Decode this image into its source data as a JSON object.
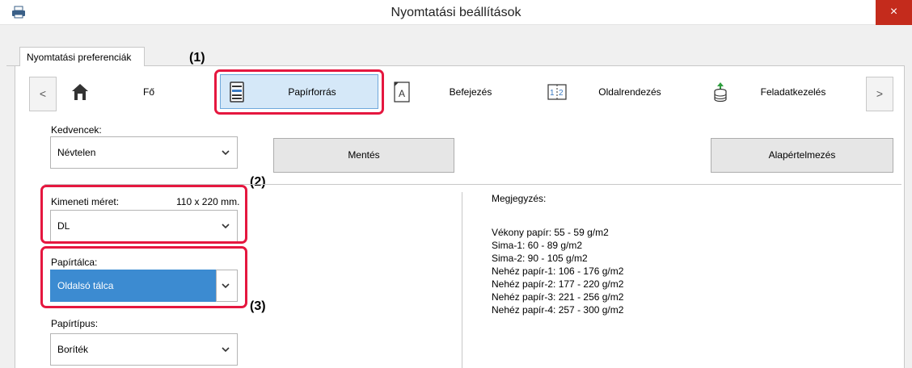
{
  "window": {
    "title": "Nyomtatási beállítások",
    "close_glyph": "×",
    "app_icon": "printer-icon"
  },
  "tab": {
    "label": "Nyomtatási preferenciák"
  },
  "callouts": {
    "c1": "(1)",
    "c2": "(2)",
    "c3": "(3)"
  },
  "nav": {
    "prev_glyph": "<",
    "next_glyph": ">",
    "items": [
      {
        "label": "Fő",
        "icon": "home-icon"
      },
      {
        "label": "Papírforrás",
        "icon": "paper-tray-icon",
        "selected": true
      },
      {
        "label": "Befejezés",
        "icon": "document-a-icon"
      },
      {
        "label": "Oldalrendezés",
        "icon": "two-page-layout-icon"
      },
      {
        "label": "Feladatkezelés",
        "icon": "job-stack-icon"
      }
    ]
  },
  "favorites": {
    "label": "Kedvencek:",
    "value": "Névtelen",
    "save_label": "Mentés",
    "default_label": "Alapértelmezés"
  },
  "output_size": {
    "label": "Kimeneti méret:",
    "dimension": "110 x 220 mm.",
    "value": "DL"
  },
  "paper_tray": {
    "label": "Papírtálca:",
    "value": "Oldalsó tálca"
  },
  "paper_type": {
    "label": "Papírtípus:",
    "value": "Boríték"
  },
  "note": {
    "title": "Megjegyzés:",
    "lines": [
      "Vékony papír: 55 - 59 g/m2",
      "Sima-1: 60 - 89 g/m2",
      "Sima-2: 90 - 105 g/m2",
      "Nehéz papír-1: 106 - 176 g/m2",
      "Nehéz papír-2: 177 - 220 g/m2",
      "Nehéz papír-3: 221 - 256 g/m2",
      "Nehéz papír-4: 257 - 300 g/m2"
    ]
  },
  "colors": {
    "highlight_red": "#e5173f",
    "selection_blue": "#3c8bd1",
    "close_red": "#c42b1c"
  }
}
